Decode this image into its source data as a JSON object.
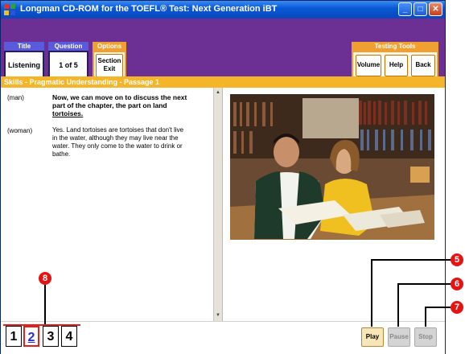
{
  "window": {
    "title": "Longman CD-ROM for the TOEFL® Test: Next Generation iBT",
    "minimize_glyph": "_",
    "maximize_glyph": "□",
    "close_glyph": "✕"
  },
  "toolbar": {
    "title_header": "Title",
    "title_value": "Listening",
    "question_header": "Question",
    "question_value": "1 of 5",
    "options_header": "Options",
    "section_exit_line1": "Section",
    "section_exit_line2": "Exit",
    "testing_tools_header": "Testing Tools",
    "volume_label": "Volume",
    "help_label": "Help",
    "back_label": "Back"
  },
  "skills_bar": "Skills - Pragmatic Understanding - Passage 1",
  "transcript": [
    {
      "speaker": "(man)",
      "line1": "Now, we can move on to discuss the next",
      "line2": "part of the chapter, the part on land",
      "line3": "tortoises.",
      "bold": true
    },
    {
      "speaker": "(woman)",
      "line1": "Yes. Land tortoises are tortoises that don't live",
      "line2": "in the water, although they may live near the",
      "line3": "water. They only come to the water to drink or",
      "line4": "bathe."
    }
  ],
  "pages": [
    {
      "label": "1",
      "active": false
    },
    {
      "label": "2",
      "active": true
    },
    {
      "label": "3",
      "active": false
    },
    {
      "label": "4",
      "active": false
    }
  ],
  "media": {
    "play_label": "Play",
    "pause_label": "Pause",
    "stop_label": "Stop"
  },
  "callouts": {
    "pages": "8",
    "play": "5",
    "pause": "6",
    "stop": "7"
  },
  "colors": {
    "purple_frame": "#6c2f94",
    "skills_bar": "#f5b52a",
    "callout_red": "#e41414",
    "header_blue": "#5a5adc",
    "header_orange": "#f0a030"
  }
}
